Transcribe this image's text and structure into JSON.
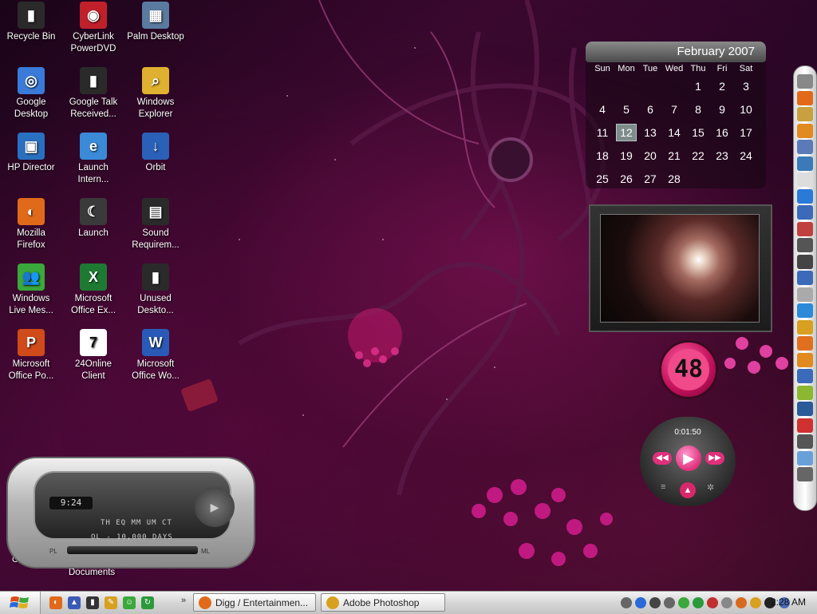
{
  "desktop": {
    "icons": [
      {
        "label": "Recycle Bin",
        "icon": "recycle-bin-icon",
        "color": "#2a2a2a",
        "glyph": "▮"
      },
      {
        "label": "CyberLink\nPowerDVD",
        "icon": "powerdvd-icon",
        "color": "#c0202a",
        "glyph": "◉"
      },
      {
        "label": "Palm Desktop",
        "icon": "palm-desktop-icon",
        "color": "#5a7aa0",
        "glyph": "▦"
      },
      {
        "label": "Google\nDesktop",
        "icon": "google-desktop-icon",
        "color": "#3a7ad8",
        "glyph": "◎"
      },
      {
        "label": "Google Talk\nReceived...",
        "icon": "folder-icon",
        "color": "#2a2a2a",
        "glyph": "▮"
      },
      {
        "label": "Windows\nExplorer",
        "icon": "windows-explorer-icon",
        "color": "#e0b030",
        "glyph": "⌕"
      },
      {
        "label": "HP Director",
        "icon": "hp-director-icon",
        "color": "#2a70c0",
        "glyph": "▣"
      },
      {
        "label": "Launch\nIntern...",
        "icon": "internet-explorer-icon",
        "color": "#3a8ad8",
        "glyph": "e"
      },
      {
        "label": "Orbit",
        "icon": "orbit-icon",
        "color": "#2a60b8",
        "glyph": "↓"
      },
      {
        "label": "Mozilla\nFirefox",
        "icon": "firefox-icon",
        "color": "#e06a1a",
        "glyph": "◐"
      },
      {
        "label": "Launch",
        "icon": "launch-moon-icon",
        "color": "#3a3a3a",
        "glyph": "☾"
      },
      {
        "label": "Sound\nRequirem...",
        "icon": "document-icon",
        "color": "#2a2a2a",
        "glyph": "▤"
      },
      {
        "label": "Windows\nLive Mes...",
        "icon": "messenger-icon",
        "color": "#3aa83a",
        "glyph": "👥"
      },
      {
        "label": "Microsoft\nOffice Ex...",
        "icon": "excel-icon",
        "color": "#1e7a32",
        "glyph": "X"
      },
      {
        "label": "Unused\nDeskto...",
        "icon": "shortcut-icon",
        "color": "#2a2a2a",
        "glyph": "▮"
      },
      {
        "label": "Microsoft\nOffice Po...",
        "icon": "powerpoint-icon",
        "color": "#d04a1a",
        "glyph": "P"
      },
      {
        "label": "24Online\nClient",
        "icon": "24online-icon",
        "color": "#ffffff",
        "glyph": "7"
      },
      {
        "label": "Microsoft\nOffice Wo...",
        "icon": "word-icon",
        "color": "#2a5ab8",
        "glyph": "W"
      }
    ],
    "documents_label": "Documents",
    "cc_label": "CC"
  },
  "calendar": {
    "month_title": "February 2007",
    "weekdays": [
      "Sun",
      "Mon",
      "Tue",
      "Wed",
      "Thu",
      "Fri",
      "Sat"
    ],
    "days": [
      "",
      "",
      "",
      "",
      "1",
      "2",
      "3",
      "4",
      "5",
      "6",
      "7",
      "8",
      "9",
      "10",
      "11",
      "12",
      "13",
      "14",
      "15",
      "16",
      "17",
      "18",
      "19",
      "20",
      "21",
      "22",
      "23",
      "24",
      "25",
      "26",
      "27",
      "28"
    ],
    "today": "12"
  },
  "counter": {
    "value": "48"
  },
  "media_gadget": {
    "elapsed": "0:01:50",
    "play_glyph": "▶",
    "prev_glyph": "◀◀",
    "next_glyph": "▶▶",
    "volume_glyph": "▲",
    "menu_glyph": "≡",
    "settings_glyph": "✲"
  },
  "skin_player": {
    "clock": "9:24",
    "line1": "TH EQ MM UM CT",
    "line2": "OL - 10,000 DAYS",
    "pl_label": "PL",
    "ml_label": "ML",
    "dpad_glyph": "▶"
  },
  "dock": {
    "items": [
      {
        "icon": "feather-icon",
        "color": "#888888"
      },
      {
        "icon": "firefox-icon",
        "color": "#e06a1a"
      },
      {
        "icon": "document-icon",
        "color": "#c8a040"
      },
      {
        "icon": "cone-icon",
        "color": "#e08a20"
      },
      {
        "icon": "users-icon",
        "color": "#5a7ab8"
      },
      {
        "icon": "google-talk-icon",
        "color": "#3a7ab8"
      },
      {
        "icon": "clock-icon",
        "color": "#dddddd"
      },
      {
        "icon": "media-player-icon",
        "color": "#2a7ad8"
      },
      {
        "icon": "picture-icon",
        "color": "#3a6ab8"
      },
      {
        "icon": "people-icon",
        "color": "#c04040"
      },
      {
        "icon": "film-icon",
        "color": "#555555"
      },
      {
        "icon": "pen-icon",
        "color": "#444444"
      },
      {
        "icon": "digg-icon",
        "color": "#3a6ab8"
      },
      {
        "icon": "mail-icon",
        "color": "#aaaaaa"
      },
      {
        "icon": "globe-icon",
        "color": "#2a8ad8"
      },
      {
        "icon": "pencil-icon",
        "color": "#d8a020"
      },
      {
        "icon": "blogger-icon",
        "color": "#e07020"
      },
      {
        "icon": "rss-icon",
        "color": "#e08a20"
      },
      {
        "icon": "flickr-icon",
        "color": "#3a6ab8"
      },
      {
        "icon": "paint-icon",
        "color": "#8ab830"
      },
      {
        "icon": "digg-icon",
        "color": "#2a5a98"
      },
      {
        "icon": "lifebuoy-icon",
        "color": "#d03030"
      },
      {
        "icon": "tools-icon",
        "color": "#555555"
      },
      {
        "icon": "recycle-bin-icon",
        "color": "#6aa0d8"
      },
      {
        "icon": "power-icon",
        "color": "#666666"
      }
    ]
  },
  "taskbar": {
    "quick_launch": [
      {
        "icon": "firefox-icon",
        "color": "#e06a1a",
        "glyph": "◐"
      },
      {
        "icon": "launcher-icon",
        "color": "#3a5ab8",
        "glyph": "▲"
      },
      {
        "icon": "terminal-icon",
        "color": "#333333",
        "glyph": "▮"
      },
      {
        "icon": "pencil-icon",
        "color": "#d8a020",
        "glyph": "✎"
      },
      {
        "icon": "messenger-icon",
        "color": "#3aa83a",
        "glyph": "☺"
      },
      {
        "icon": "refresh-icon",
        "color": "#2a9a3a",
        "glyph": "↻"
      }
    ],
    "overflow_glyph": "»",
    "tasks": [
      {
        "label": "Digg / Entertainmen...",
        "icon": "firefox-icon",
        "color": "#e06a1a"
      },
      {
        "label": "Adobe Photoshop",
        "icon": "photoshop-icon",
        "color": "#d8a020"
      }
    ],
    "tray_icons": [
      {
        "icon": "tray-arrow-icon",
        "color": "#666666"
      },
      {
        "icon": "media-icon",
        "color": "#2a6ad8"
      },
      {
        "icon": "camera-icon",
        "color": "#444444"
      },
      {
        "icon": "network-icon",
        "color": "#666666"
      },
      {
        "icon": "messenger-icon",
        "color": "#3aa83a"
      },
      {
        "icon": "update-icon",
        "color": "#2a9a3a"
      },
      {
        "icon": "stop-icon",
        "color": "#c03030"
      },
      {
        "icon": "security-icon",
        "color": "#888888"
      },
      {
        "icon": "alert-icon",
        "color": "#d86a20"
      },
      {
        "icon": "pencil-icon",
        "color": "#d8a020"
      },
      {
        "icon": "24online-icon",
        "color": "#222222"
      },
      {
        "icon": "network-computers-icon",
        "color": "#4a6ab8"
      }
    ],
    "clock": "2:28 AM"
  }
}
